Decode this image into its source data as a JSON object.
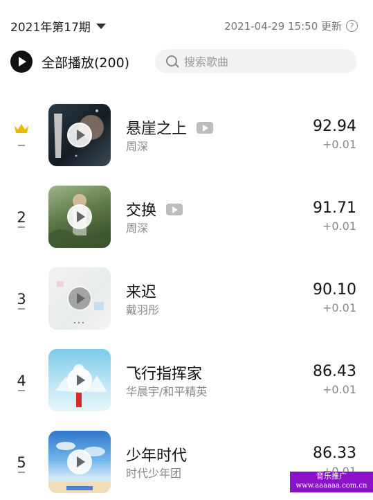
{
  "header": {
    "period": "2021年第17期",
    "updated": "2021-04-29 15:50 更新"
  },
  "toolbar": {
    "play_all": "全部播放(200)",
    "search_placeholder": "搜索歌曲"
  },
  "songs": [
    {
      "rank": "",
      "title": "悬崖之上",
      "artist": "周深",
      "score": "92.94",
      "delta": "+0.01",
      "has_mv": true
    },
    {
      "rank": "2",
      "title": "交换",
      "artist": "周深",
      "score": "91.71",
      "delta": "+0.01",
      "has_mv": true
    },
    {
      "rank": "3",
      "title": "来迟",
      "artist": "戴羽彤",
      "score": "90.10",
      "delta": "+0.01",
      "has_mv": false
    },
    {
      "rank": "4",
      "title": "飞行指挥家",
      "artist": "华晨宇/和平精英",
      "score": "86.43",
      "delta": "+0.01",
      "has_mv": false
    },
    {
      "rank": "5",
      "title": "少年时代",
      "artist": "时代少年团",
      "score": "86.33",
      "delta": "+0.01",
      "has_mv": false
    }
  ],
  "watermark": {
    "line1": "音乐推广",
    "line2": "www.aaaaaa.com.cn"
  },
  "colors": {
    "crown": "#e9b600",
    "watermark_bg": "#8a12c7"
  }
}
